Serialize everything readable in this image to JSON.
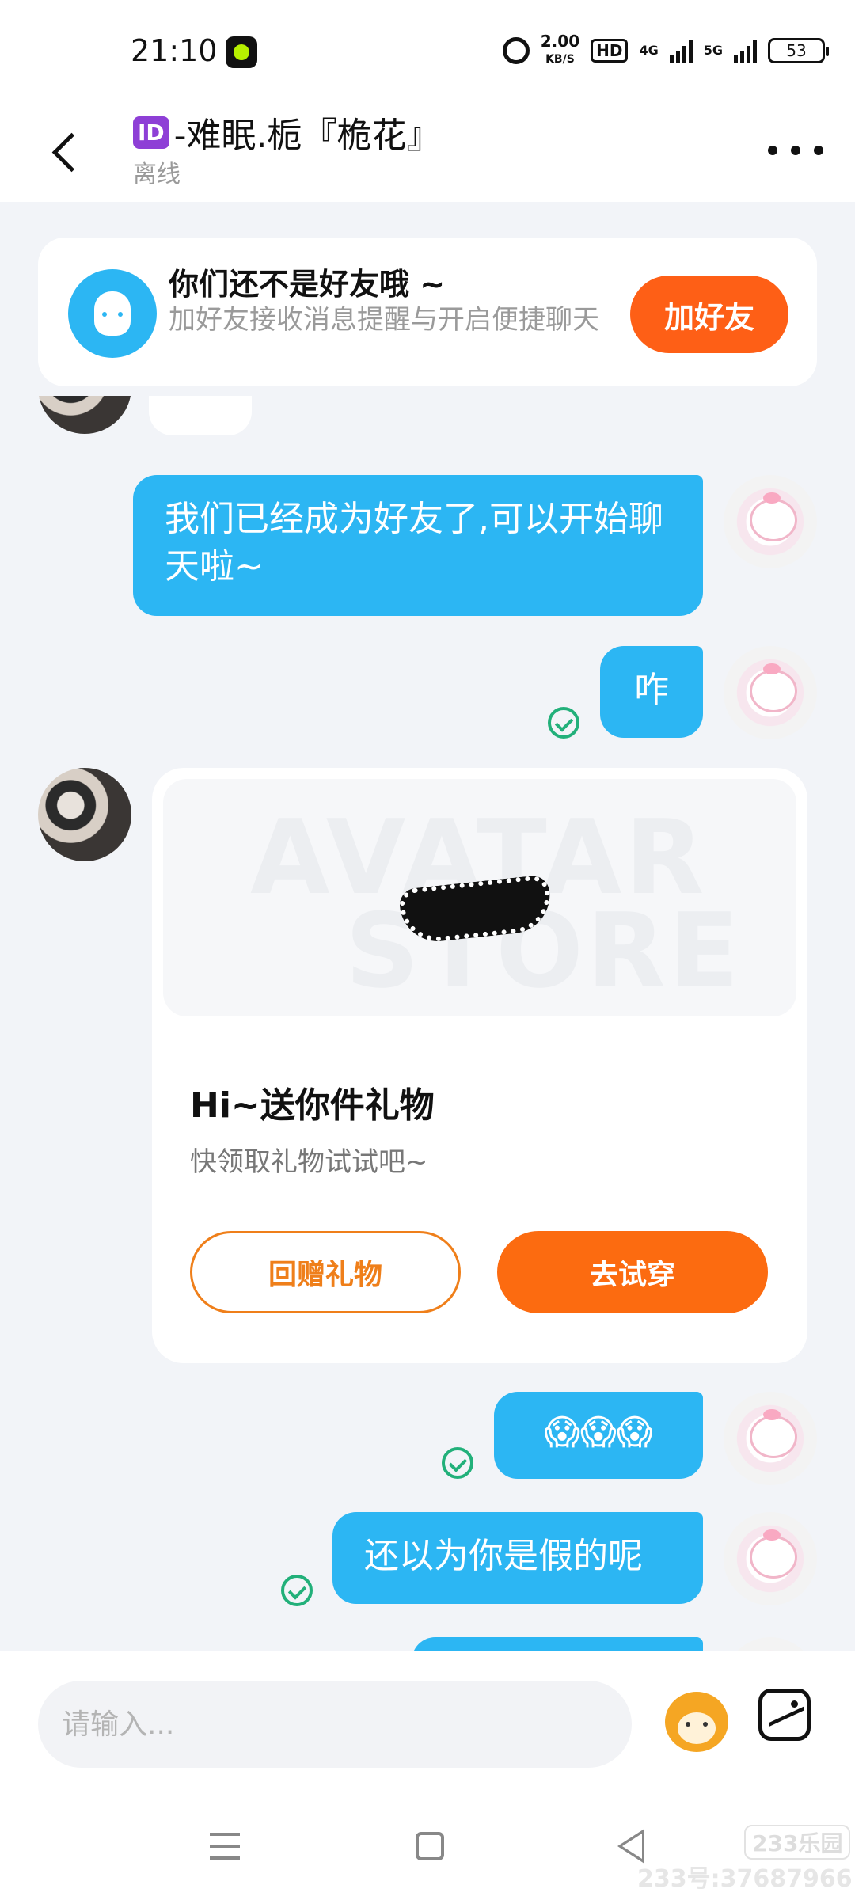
{
  "status_bar": {
    "time": "21:10",
    "net_speed_value": "2.00",
    "net_speed_unit": "KB/S",
    "hd_label": "HD",
    "signal1_label": "4G",
    "signal2_label": "5G",
    "battery": "53"
  },
  "header": {
    "id_badge": "ID",
    "title": "-难眠.栀『桅花』",
    "subtitle": "离线"
  },
  "banner": {
    "title": "你们还不是好友哦 ~",
    "description": "加好友接收消息提醒与开启便捷聊天",
    "button_label": "加好友"
  },
  "messages": [
    {
      "sender": "me",
      "text": "我们已经成为好友了,可以开始聊天啦~"
    },
    {
      "sender": "me",
      "text": "咋",
      "read": true
    },
    {
      "sender": "me",
      "text": "😱😱😱",
      "read": true
    },
    {
      "sender": "me",
      "text": "还以为你是假的呢",
      "read": true
    }
  ],
  "gift_card": {
    "watermark_line1": "AVATAR",
    "watermark_line2": "STORE",
    "title": "Hi~送你件礼物",
    "description": "快领取礼物试试吧~",
    "return_button": "回赠礼物",
    "tryon_button": "去试穿"
  },
  "input": {
    "placeholder": "请输入..."
  },
  "watermark": {
    "logo": "233乐园",
    "text": "233号:37687966"
  },
  "colors": {
    "accent_blue": "#2cb6f3",
    "accent_orange": "#fe5f16",
    "read_green": "#22b07a"
  }
}
